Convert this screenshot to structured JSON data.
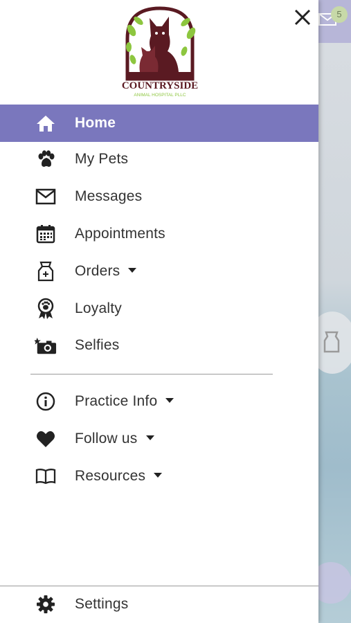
{
  "header": {
    "logo_text": "COUNTRYSIDE",
    "logo_subtext": "ANIMAL HOSPITAL PLLC"
  },
  "background": {
    "notification_count": "5"
  },
  "menu": {
    "home": "Home",
    "my_pets": "My Pets",
    "messages": "Messages",
    "appointments": "Appointments",
    "orders": "Orders",
    "loyalty": "Loyalty",
    "selfies": "Selfies",
    "practice_info": "Practice Info",
    "follow_us": "Follow us",
    "resources": "Resources",
    "settings": "Settings"
  },
  "colors": {
    "active": "#7a77bd",
    "logo_brown": "#5a1a22",
    "logo_green": "#8dc63f"
  }
}
